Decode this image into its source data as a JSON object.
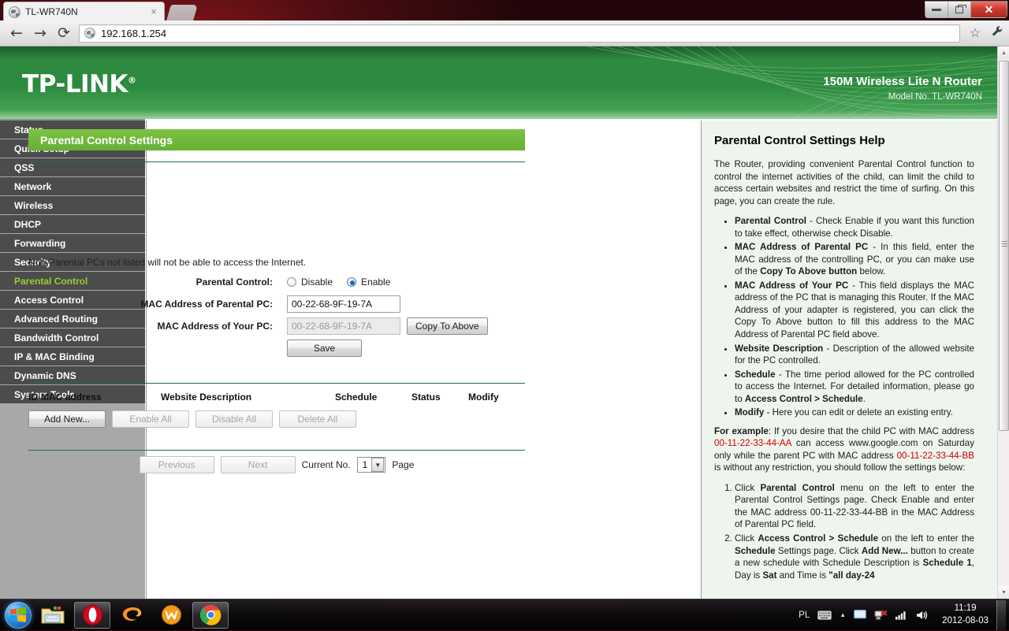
{
  "browser": {
    "tab_title": "TL-WR740N",
    "tab_close": "×",
    "url": "192.168.1.254",
    "back_icon": "←",
    "forward_icon": "→",
    "reload_icon": "⟳",
    "star_icon": "☆",
    "wrench_icon": "🔧",
    "minimize_label": "",
    "maximize_label": "",
    "close_label": "✕"
  },
  "router": {
    "brand": "TP-LINK",
    "brand_reg": "®",
    "model_title": "150M Wireless Lite N Router",
    "model_no": "Model No. TL-WR740N"
  },
  "sidebar": {
    "items": [
      {
        "label": "Status",
        "active": false
      },
      {
        "label": "Quick Setup",
        "active": false
      },
      {
        "label": "QSS",
        "active": false
      },
      {
        "label": "Network",
        "active": false
      },
      {
        "label": "Wireless",
        "active": false
      },
      {
        "label": "DHCP",
        "active": false
      },
      {
        "label": "Forwarding",
        "active": false
      },
      {
        "label": "Security",
        "active": false
      },
      {
        "label": "Parental Control",
        "active": true
      },
      {
        "label": "Access Control",
        "active": false
      },
      {
        "label": "Advanced Routing",
        "active": false
      },
      {
        "label": "Bandwidth Control",
        "active": false
      },
      {
        "label": "IP & MAC Binding",
        "active": false
      },
      {
        "label": "Dynamic DNS",
        "active": false
      },
      {
        "label": "System Tools",
        "active": false
      }
    ]
  },
  "main": {
    "page_title": "Parental Control Settings",
    "note": "Non-Parental PCs not listed will not be able to access the Internet.",
    "parental_control_label": "Parental Control:",
    "radio_disable": "Disable",
    "radio_enable": "Enable",
    "selected_radio": "Enable",
    "mac_parental_label": "MAC Address of Parental PC:",
    "mac_parental_value": "00-22-68-9F-19-7A",
    "mac_your_label": "MAC Address of Your PC:",
    "mac_your_value": "00-22-68-9F-19-7A",
    "copy_to_above": "Copy To Above",
    "save": "Save",
    "table_headers": {
      "id": "ID",
      "mac": "MAC address",
      "website": "Website Description",
      "schedule": "Schedule",
      "status": "Status",
      "modify": "Modify"
    },
    "actions": {
      "add_new": "Add New...",
      "enable_all": "Enable All",
      "disable_all": "Disable All",
      "delete_all": "Delete All"
    },
    "pager": {
      "previous": "Previous",
      "next": "Next",
      "current_no_label": "Current No.",
      "current_page": "1",
      "page_label": "Page",
      "dropdown_arrow": "▼"
    }
  },
  "help": {
    "title": "Parental Control Settings Help",
    "intro": "The Router, providing convenient Parental Control function to control the internet activities of the child, can limit the child to access certain websites and restrict the time of surfing. On this page, you can create the rule.",
    "bullets": [
      {
        "term": "Parental Control",
        "text": " - Check Enable if you want this function to take effect, otherwise check Disable."
      },
      {
        "term": "MAC Address of Parental PC",
        "text": " - In this field, enter the MAC address of the controlling PC, or you can make use of the ",
        "bold_mid": "Copy To Above button",
        "text2": " below."
      },
      {
        "term": "MAC Address of Your PC",
        "text": " - This field displays the MAC address of the PC that is managing this Router. If the MAC Address of your adapter is registered, you can click the Copy To Above button to fill this address to the MAC Address of Parental PC field above."
      },
      {
        "term": "Website Description",
        "text": " - Description of the allowed website for the PC controlled."
      },
      {
        "term": "Schedule",
        "text": " - The time period allowed for the PC controlled to access the Internet. For detailed information, please go to ",
        "bold_mid": "Access Control > Schedule",
        "text2": "."
      },
      {
        "term": "Modify",
        "text": " - Here you can edit or delete an existing entry."
      }
    ],
    "example_label": "For example",
    "example_p1": ": If you desire that the child PC with MAC address ",
    "example_mac1": "00-11-22-33-44-AA",
    "example_p2": " can access www.google.com on Saturday only while the parent PC with MAC address ",
    "example_mac2": "00-11-22-33-44-BB",
    "example_p3": " is without any restriction, you should follow the settings below:",
    "steps": [
      {
        "pre": "Click ",
        "bold1": "Parental Control",
        "mid": " menu on the left to enter the Parental Control Settings page. Check Enable and enter the MAC address 00-11-22-33-44-BB in the MAC Address of Parental PC field."
      },
      {
        "pre": "Click ",
        "bold1": "Access Control > Schedule",
        "mid": " on the left to enter the ",
        "bold2": "Schedule",
        "mid2": " Settings page. Click ",
        "bold3": "Add New...",
        "mid3": " button to create a new schedule with Schedule Description is ",
        "bold4": "Schedule 1",
        "mid4": ", Day is ",
        "bold5": "Sat",
        "mid5": " and Time is ",
        "bold6": "\"all day-24"
      }
    ]
  },
  "taskbar": {
    "start": "start-orb",
    "items": [
      {
        "name": "explorer",
        "active": false
      },
      {
        "name": "opera",
        "active": true
      },
      {
        "name": "gg",
        "active": false
      },
      {
        "name": "winamp",
        "active": false
      },
      {
        "name": "chrome",
        "active": true
      }
    ],
    "tray": {
      "language": "PL",
      "keyboard_icon": "keyboard-icon",
      "show_hidden_icon": "▲",
      "monitor_icon": "monitor-icon",
      "network_icon": "network-icon",
      "signal_icon": "signal-icon",
      "volume_icon": "🔊"
    },
    "time": "11:19",
    "date": "2012-08-03"
  }
}
